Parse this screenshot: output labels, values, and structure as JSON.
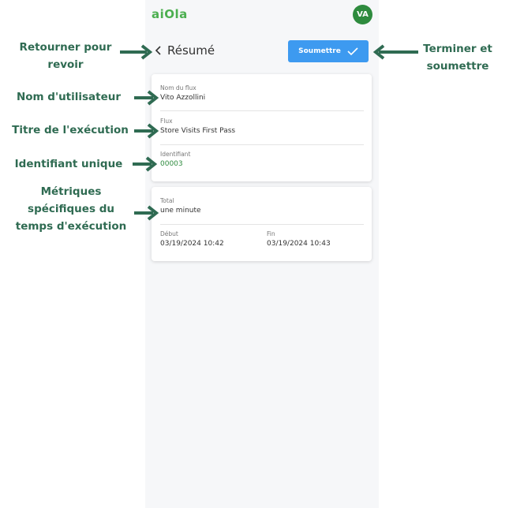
{
  "app": {
    "logo": "aiOla",
    "avatar_initials": "VA"
  },
  "header": {
    "back_label": "Résumé",
    "submit_label": "Soumettre"
  },
  "card1": {
    "flow_name_label": "Nom du flux",
    "flow_name_value": "Vito Azzollini",
    "flow_label": "Flux",
    "flow_value": "Store Visits First Pass",
    "id_label": "Identifiant",
    "id_value": "00003"
  },
  "card2": {
    "total_label": "Total",
    "total_value": "une minute",
    "start_label": "Début",
    "start_value": "03/19/2024 10:42",
    "end_label": "Fin",
    "end_value": "03/19/2024 10:43"
  },
  "annotations": {
    "back": [
      "Retourner pour",
      "revoir"
    ],
    "submit": [
      "Terminer et",
      "soumettre"
    ],
    "user": "Nom d'utilisateur",
    "title": "Titre de l'exécution",
    "id": "Identifiant unique",
    "metrics": [
      "Métriques",
      "spécifiques du",
      "temps d'exécution"
    ]
  },
  "colors": {
    "accent": "#3d9af0",
    "brand": "#2e8b3e",
    "annotation": "#2f6b52"
  }
}
